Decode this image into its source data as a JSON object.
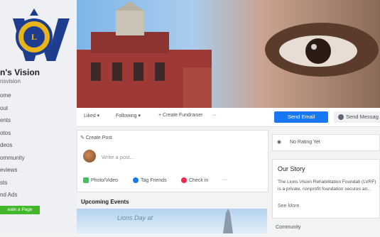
{
  "sidebar": {
    "page_name": "n's Vision",
    "page_handle": "nsvision",
    "nav": [
      "ome",
      "out",
      "ents",
      "otos",
      "deos",
      "ommunity",
      "eviews",
      "sts",
      "nd Ads"
    ],
    "create_page": "eate a Page"
  },
  "action_bar": {
    "liked": "Liked ▾",
    "following": "Following ▾",
    "create_fundraiser": "+ Create Fundraiser",
    "more": "···",
    "send_email": "Send Email",
    "send_message": "Send Messag"
  },
  "composer": {
    "create_post": "Create Post",
    "placeholder": "Write a post...",
    "photo_video": "Photo/Video",
    "tag_friends": "Tag Friends",
    "check_in": "Check in",
    "more": "···"
  },
  "events": {
    "title": "Upcoming Events",
    "image_text": "Lions Day at"
  },
  "right": {
    "rating": "No Rating Yet",
    "story_title": "Our Story",
    "story_body": "The Lions Vision Rehabilitation Foundati (LVRF) is a private, nonprofit foundation secures an...",
    "see_more": "See More",
    "community": "Community"
  },
  "colors": {
    "primary": "#1877f2",
    "create_page": "#42b72a",
    "logo_blue": "#1e3d8f",
    "logo_gold": "#e9b51a"
  }
}
